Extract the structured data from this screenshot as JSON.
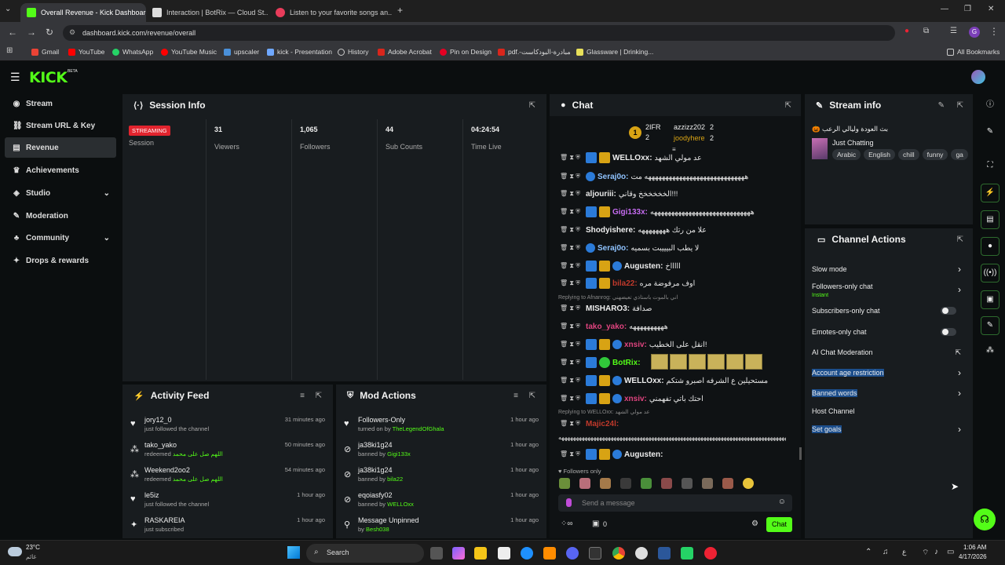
{
  "browser": {
    "tabs": [
      {
        "title": "Overall Revenue - Kick Dashboard",
        "active": true
      },
      {
        "title": "Interaction | BotRix — Cloud St..."
      },
      {
        "title": "Listen to your favorite songs an..."
      }
    ],
    "url": "dashboard.kick.com/revenue/overall",
    "bookmarks": [
      "Gmail",
      "YouTube",
      "WhatsApp",
      "YouTube Music",
      "upscaler",
      "kick - Presentation",
      "History",
      "Adobe Acrobat",
      "Pin on Design",
      "pdf.-مبادرة-البودكاست",
      "Glassware | Drinking..."
    ],
    "all_bookmarks": "All Bookmarks"
  },
  "app": {
    "logo": "KICK",
    "logo_sup": "BETA"
  },
  "sidebar": {
    "items": [
      {
        "label": "Stream",
        "icon": "broadcast-icon"
      },
      {
        "label": "Stream URL & Key",
        "icon": "link-icon"
      },
      {
        "label": "Revenue",
        "icon": "chart-icon",
        "selected": true
      },
      {
        "label": "Achievements",
        "icon": "trophy-icon"
      },
      {
        "label": "Studio",
        "icon": "studio-icon",
        "chevron": true
      },
      {
        "label": "Moderation",
        "icon": "wrench-icon"
      },
      {
        "label": "Community",
        "icon": "community-icon",
        "chevron": true
      },
      {
        "label": "Drops & rewards",
        "icon": "gift-icon"
      }
    ]
  },
  "session": {
    "title": "Session Info",
    "status_badge": "STREAMING",
    "stats": [
      {
        "value": "",
        "label": "Session"
      },
      {
        "value": "31",
        "label": "Viewers"
      },
      {
        "value": "1,065",
        "label": "Followers"
      },
      {
        "value": "44",
        "label": "Sub Counts"
      },
      {
        "value": "04:24:54",
        "label": "Time Live"
      }
    ]
  },
  "activity": {
    "title": "Activity Feed",
    "rows": [
      {
        "icon": "heart-icon",
        "name": "jory12_0",
        "desc": "just followed the channel",
        "extra": "",
        "time": "31 minutes ago"
      },
      {
        "icon": "redeem-icon",
        "name": "tako_yako",
        "desc": "redeemed",
        "extra": "اللهم صل على محمد",
        "time": "50 minutes ago"
      },
      {
        "icon": "redeem-icon",
        "name": "Weekend2oo2",
        "desc": "redeemed",
        "extra": "اللهم صل على محمد",
        "time": "54 minutes ago"
      },
      {
        "icon": "heart-icon",
        "name": "le5iz",
        "desc": "just followed the channel",
        "extra": "",
        "time": "1 hour ago"
      },
      {
        "icon": "star-icon",
        "name": "RASKAREIA",
        "desc": "just subscribed",
        "extra": "",
        "time": "1 hour ago"
      }
    ]
  },
  "mod": {
    "title": "Mod Actions",
    "rows": [
      {
        "icon": "heart-icon",
        "name": "Followers-Only",
        "desc": "turned on by",
        "extra": "TheLegendOfGhala",
        "time": "1 hour ago"
      },
      {
        "icon": "ban-icon",
        "name": "ja38ki1g24",
        "desc": "banned by",
        "extra": "Gigi133x",
        "time": "1 hour ago"
      },
      {
        "icon": "ban-icon",
        "name": "ja38ki1g24",
        "desc": "banned by",
        "extra": "bila22",
        "time": "1 hour ago"
      },
      {
        "icon": "ban-icon",
        "name": "eqoiasfy02",
        "desc": "banned by",
        "extra": "WELLOxx",
        "time": "1 hour ago"
      },
      {
        "icon": "unpin-icon",
        "name": "Message Unpinned",
        "desc": "by",
        "extra": "Besh038",
        "time": "1 hour ago"
      }
    ]
  },
  "chat": {
    "title": "Chat",
    "top_gifters": [
      {
        "name": "2IFR",
        "count": "2"
      },
      {
        "name": "azzizz202",
        "count": "2"
      },
      {
        "name": "2",
        "count": ""
      },
      {
        "name": "joodyhere",
        "count": "2"
      }
    ],
    "messages": [
      {
        "user": "WELLOxx:",
        "color": "#eeeeee",
        "text": "عد مولي الشهد",
        "badges": [
          "b-blue",
          "b-gold"
        ]
      },
      {
        "user": "Seraj0o:",
        "color": "#8fc3ff",
        "text": "هههههههههههههههههههههههههههههه مت",
        "badges": [
          "b-sub"
        ]
      },
      {
        "user": "aljouriii:",
        "color": "#e8e8e8",
        "text": "الخخخخخخ وقاني!!!",
        "badges": []
      },
      {
        "user": "Gigi133x:",
        "color": "#c56cf0",
        "text": "هههههههههههههههههههههههههههههه",
        "badges": [
          "b-blue",
          "b-gold"
        ]
      },
      {
        "user": "Shodyishere:",
        "color": "#eeeeee",
        "text": "علا من رتك ههههههههه",
        "badges": []
      },
      {
        "user": "Seraj0o:",
        "color": "#8fc3ff",
        "text": "لا يطب البيييبت بسميه",
        "badges": [
          "b-sub"
        ]
      },
      {
        "user": "Augusten:",
        "color": "#eeeeee",
        "text": "اااااخ",
        "badges": [
          "b-blue",
          "b-gold",
          "b-sub"
        ]
      },
      {
        "user": "bila22:",
        "color": "#c0392b",
        "text": "اوف مرفوضة مره",
        "badges": [
          "b-blue",
          "b-gold"
        ]
      },
      {
        "user": "MISHARO3:",
        "color": "#eeeeee",
        "text": "صدافة",
        "badges": []
      },
      {
        "user": "tako_yako:",
        "color": "#e0447f",
        "text": "ههههههههههه",
        "badges": []
      },
      {
        "user": "xnsiv:",
        "color": "#e0447f",
        "text": "انقل على الخطيب!",
        "badges": [
          "b-blue",
          "b-gold",
          "b-sub"
        ]
      },
      {
        "user": "BotRix:",
        "color": "#53fc18",
        "text": "",
        "badges": [
          "b-blue",
          "b-green"
        ]
      },
      {
        "user": "WELLOxx:",
        "color": "#eeeeee",
        "text": "مستحيلين ع الشرفه اصبرو شتكم",
        "badges": [
          "b-blue",
          "b-gold",
          "b-sub"
        ]
      },
      {
        "user": "xnsiv:",
        "color": "#e0447f",
        "text": "احتك باتي تفهمني",
        "badges": [
          "b-blue",
          "b-gold",
          "b-sub"
        ]
      },
      {
        "user": "Majic24l:",
        "color": "#c0392b",
        "text": "",
        "badges": []
      },
      {
        "user": "Augusten:",
        "color": "#eeeeee",
        "text": "",
        "badges": [
          "b-blue",
          "b-gold",
          "b-sub"
        ]
      }
    ],
    "reply1": "Replying to Afnanrog: اني بالموت باستاذي تعيضهني",
    "reply2": "Replying to WELLOxx: عد مولي الشهد",
    "long_msg": "ههههههههههههههههههههههههههههههههههههههههههههههههههههههههههههههههههههههههههههههههههههه",
    "followers_only": "Followers only",
    "placeholder": "Send a message",
    "count": "0",
    "send_label": "Chat"
  },
  "stream_info": {
    "title": "Stream info",
    "stream_title": "بث العودة وليالي الرعب 🎃",
    "category": "Just Chatting",
    "tags": [
      "Arabic",
      "English",
      "chill",
      "funny",
      "ga"
    ]
  },
  "channel_actions": {
    "title": "Channel Actions",
    "items": [
      {
        "label": "Slow mode",
        "sub": "",
        "type": "chevron"
      },
      {
        "label": "Followers-only chat",
        "sub": "Instant",
        "type": "chevron"
      },
      {
        "label": "Subscribers-only chat",
        "sub": "",
        "type": "toggle"
      },
      {
        "label": "Emotes-only chat",
        "sub": "",
        "type": "toggle"
      },
      {
        "label": "AI Chat Moderation",
        "sub": "",
        "type": "external"
      },
      {
        "label": "Account age restriction",
        "sub": "",
        "type": "chevron",
        "highlight": true
      },
      {
        "label": "Banned words",
        "sub": "",
        "type": "chevron",
        "highlight": true
      },
      {
        "label": "Host Channel",
        "sub": "",
        "type": "none"
      },
      {
        "label": "Set goals",
        "sub": "",
        "type": "chevron",
        "highlight": true
      }
    ]
  },
  "taskbar": {
    "weather_temp": "23°C",
    "weather_desc": "غائم",
    "search": "Search",
    "time": "1:06 AM",
    "date": "4/17/2026"
  },
  "colors": {
    "accent": "#53fc18",
    "panel": "#181c1f",
    "bg": "#0b0e0f",
    "streaming": "#e2242e"
  }
}
